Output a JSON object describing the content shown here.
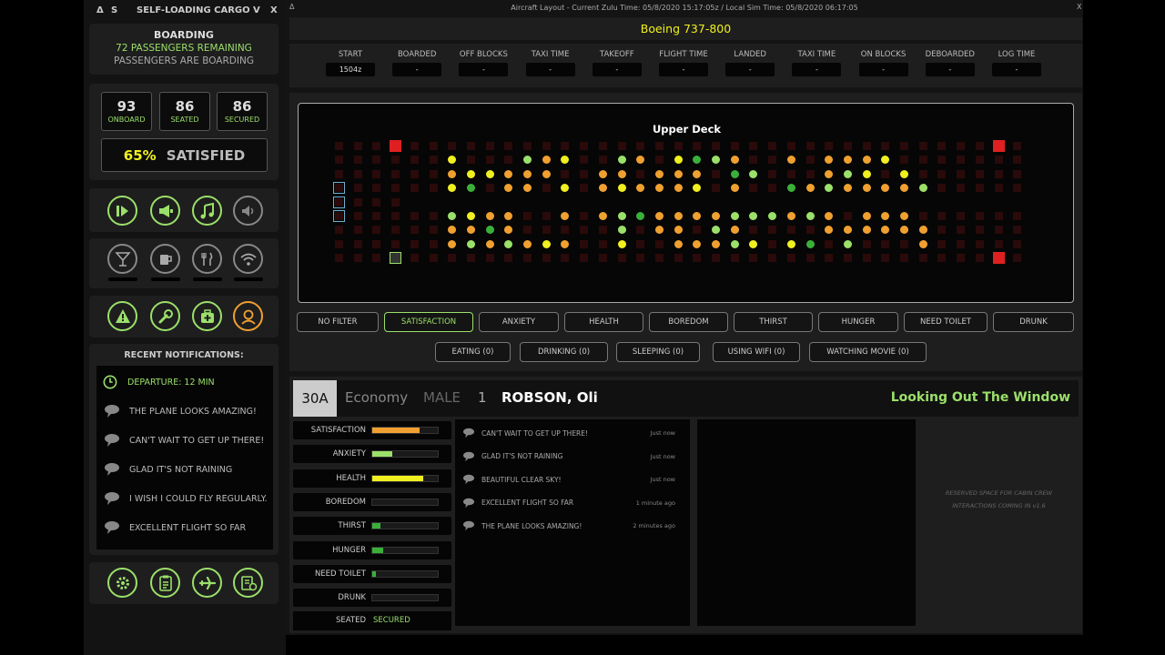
{
  "left_panel": {
    "titlebar": {
      "btn_a": "Δ",
      "btn_s": "S",
      "title": "SELF-LOADING CARGO",
      "btn_v": "V",
      "btn_x": "X"
    },
    "boarding": {
      "title": "BOARDING",
      "remaining": "72 PASSENGERS REMAINING",
      "status": "PASSENGERS ARE BOARDING"
    },
    "stats": [
      {
        "value": "93",
        "label": "ONBOARD"
      },
      {
        "value": "86",
        "label": "SEATED"
      },
      {
        "value": "86",
        "label": "SECURED"
      }
    ],
    "satisfaction": {
      "percent": "65%",
      "label": "SATISFIED"
    },
    "notifications": {
      "header": "RECENT NOTIFICATIONS:",
      "items": [
        "DEPARTURE: 12 MIN",
        "THE PLANE LOOKS AMAZING!",
        "CAN'T WAIT TO GET UP THERE!",
        "GLAD IT'S NOT RAINING",
        "I WISH I COULD FLY REGULARLY.",
        "EXCELLENT FLIGHT SO FAR"
      ]
    }
  },
  "main_window": {
    "titlebar": {
      "btn_a": "Δ",
      "title": "Aircraft Layout - Current Zulu Time: 05/8/2020 15:17:05z / Local Sim Time: 05/8/2020 06:17:05",
      "btn_x": "X"
    },
    "aircraft": "Boeing 737-800",
    "timeline": [
      {
        "label": "START",
        "value": "1504z"
      },
      {
        "label": "BOARDED",
        "value": "-"
      },
      {
        "label": "OFF BLOCKS",
        "value": "-"
      },
      {
        "label": "TAXI TIME",
        "value": "-"
      },
      {
        "label": "TAKEOFF",
        "value": "-"
      },
      {
        "label": "FLIGHT TIME",
        "value": "-"
      },
      {
        "label": "LANDED",
        "value": "-"
      },
      {
        "label": "TAXI TIME",
        "value": "-"
      },
      {
        "label": "ON BLOCKS",
        "value": "-"
      },
      {
        "label": "DEBOARDED",
        "value": "-"
      },
      {
        "label": "LOG TIME",
        "value": "-"
      }
    ],
    "deck_title": "Upper Deck",
    "filters_row1": [
      "NO FILTER",
      "SATISFACTION",
      "ANXIETY",
      "HEALTH",
      "BOREDOM",
      "THIRST",
      "HUNGER",
      "NEED TOILET",
      "DRUNK"
    ],
    "filters_row2": [
      "EATING (0)",
      "DRINKING (0)",
      "SLEEPING (0)",
      "USING WIFI (0)",
      "WATCHING MOVIE (0)"
    ],
    "passenger": {
      "seat": "30A",
      "class": "Economy",
      "gender": "MALE",
      "count": "1",
      "name": "ROBSON, Oli",
      "activity": "Looking Out The Window",
      "meters": [
        {
          "label": "SATISFACTION",
          "value": 0.72,
          "color": "#f0a030"
        },
        {
          "label": "ANXIETY",
          "value": 0.3,
          "color": "#9be06a"
        },
        {
          "label": "HEALTH",
          "value": 0.78,
          "color": "#f0f020"
        },
        {
          "label": "BOREDOM",
          "value": 0,
          "color": "#3ab03a"
        },
        {
          "label": "THIRST",
          "value": 0.12,
          "color": "#3ab03a"
        },
        {
          "label": "HUNGER",
          "value": 0.17,
          "color": "#3ab03a"
        },
        {
          "label": "NEED TOILET",
          "value": 0.06,
          "color": "#3ab03a"
        },
        {
          "label": "DRUNK",
          "value": 0,
          "color": "#3ab03a"
        }
      ],
      "seated": "SEATED",
      "secured": "SECURED",
      "comments": [
        {
          "text": "CAN'T WAIT TO GET UP THERE!",
          "time": "Just now"
        },
        {
          "text": "GLAD IT'S NOT RAINING",
          "time": "Just now"
        },
        {
          "text": "BEAUTIFUL CLEAR SKY!",
          "time": "Just now"
        },
        {
          "text": "EXCELLENT FLIGHT SO FAR",
          "time": "1 minute ago"
        },
        {
          "text": "THE PLANE LOOKS AMAZING!",
          "time": "2 minutes ago"
        }
      ],
      "reserved_line1": "RESERVED SPACE FOR CABIN CREW",
      "reserved_line2": "INTERACTIONS COMING IN v1.6"
    }
  },
  "colors": {
    "accent_green": "#9be06a",
    "orange": "#f0a030",
    "yellow": "#f0f020",
    "red": "#e02020"
  }
}
